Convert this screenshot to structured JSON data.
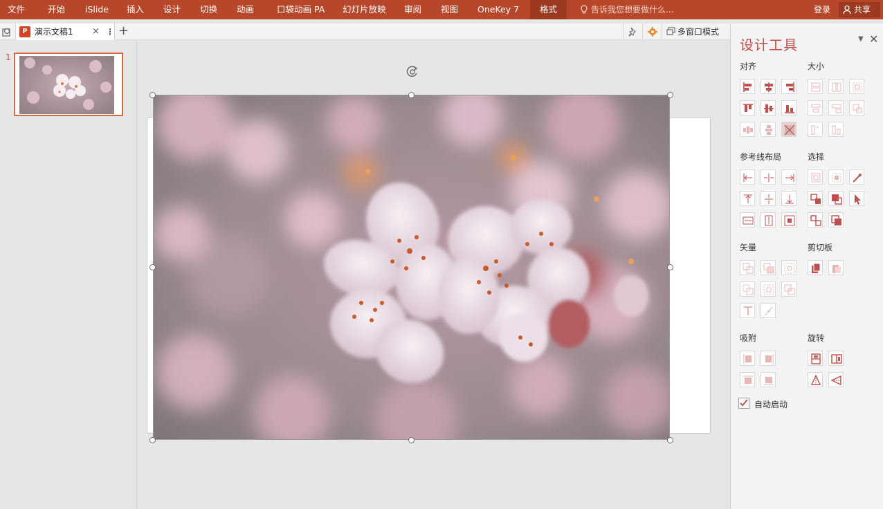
{
  "ribbon": {
    "tabs": [
      "文件",
      "开始",
      "iSlide",
      "插入",
      "设计",
      "切换",
      "动画",
      "口袋动画 PA",
      "幻灯片放映",
      "审阅",
      "视图",
      "OneKey 7",
      "格式"
    ],
    "active_tab": "格式",
    "tell_me": "告诉我您想要做什么...",
    "login": "登录",
    "share": "共享",
    "background": "#b7472a"
  },
  "tabbar": {
    "doc_icon": "P",
    "doc_name": "演示文稿1",
    "close": "×",
    "more": "⋮",
    "add": "+",
    "multi_window": "多窗口模式"
  },
  "thumbnails": [
    {
      "number": "1"
    }
  ],
  "panel": {
    "title": "设计工具",
    "sections": {
      "align": "对齐",
      "size": "大小",
      "guides": "参考线布局",
      "select": "选择",
      "vector": "矢量",
      "clipboard": "剪切板",
      "snap": "吸附",
      "rotate": "旋转"
    },
    "auto_start": "自动启动",
    "accent": "#c0504d"
  }
}
